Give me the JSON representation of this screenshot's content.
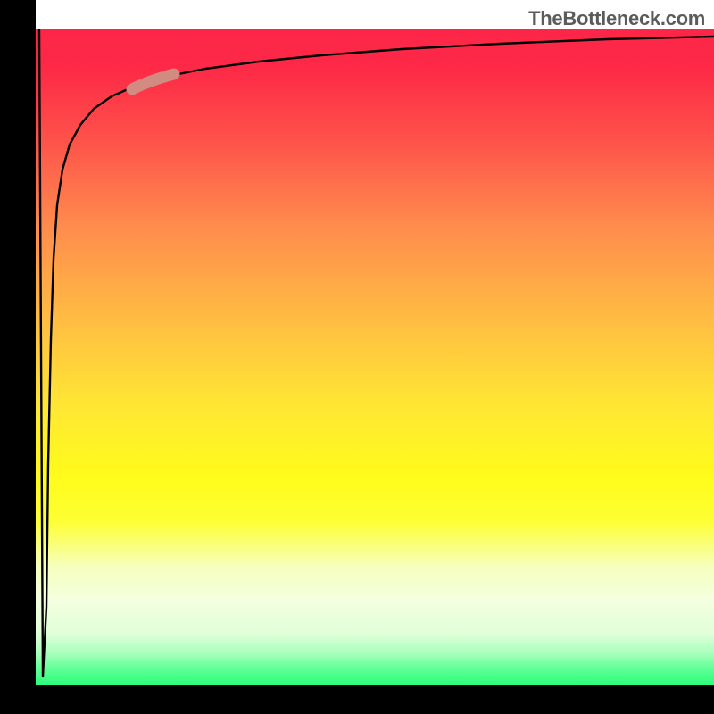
{
  "attribution": "TheBottleneck.com",
  "colors": {
    "gradient_top": "#fd2648",
    "gradient_mid": "#ffe833",
    "gradient_bottom": "#29ff7d",
    "axis": "#000000",
    "curve": "#000000",
    "highlight": "#d18b80",
    "attribution_text": "#5b5b5b"
  },
  "chart_data": {
    "type": "line",
    "title": "",
    "xlabel": "",
    "ylabel": "",
    "xlim": [
      0,
      100
    ],
    "ylim": [
      0,
      100
    ],
    "grid": false,
    "legend": false,
    "note": "Axes are unlabeled; values are read off the plotting area as percentages of each axis range.",
    "series": [
      {
        "name": "curve",
        "x": [
          0.5,
          1.0,
          1.5,
          1.8,
          2.2,
          2.6,
          3.2,
          3.9,
          5.0,
          6.6,
          8.6,
          11.2,
          14.5,
          19.1,
          25.0,
          32.9,
          42.1,
          53.9,
          68.4,
          84.2,
          100.0
        ],
        "y": [
          99.7,
          1.4,
          12.0,
          33.7,
          52.7,
          64.9,
          73.1,
          78.5,
          82.3,
          85.3,
          87.8,
          89.7,
          91.2,
          92.7,
          93.9,
          95.0,
          96.0,
          96.9,
          97.7,
          98.4,
          98.8
        ]
      }
    ],
    "highlight_segment": {
      "x_range": [
        14.2,
        20.4
      ],
      "y_range": [
        90.8,
        93.1
      ],
      "color": "#d18b80"
    },
    "background_gradient": {
      "orientation": "vertical",
      "stops": [
        {
          "pos": 0.0,
          "color": "#fd2648"
        },
        {
          "pos": 0.3,
          "color": "#ff8b4d"
        },
        {
          "pos": 0.58,
          "color": "#ffe833"
        },
        {
          "pos": 0.82,
          "color": "#f6ffbe"
        },
        {
          "pos": 1.0,
          "color": "#29ff7d"
        }
      ]
    }
  }
}
